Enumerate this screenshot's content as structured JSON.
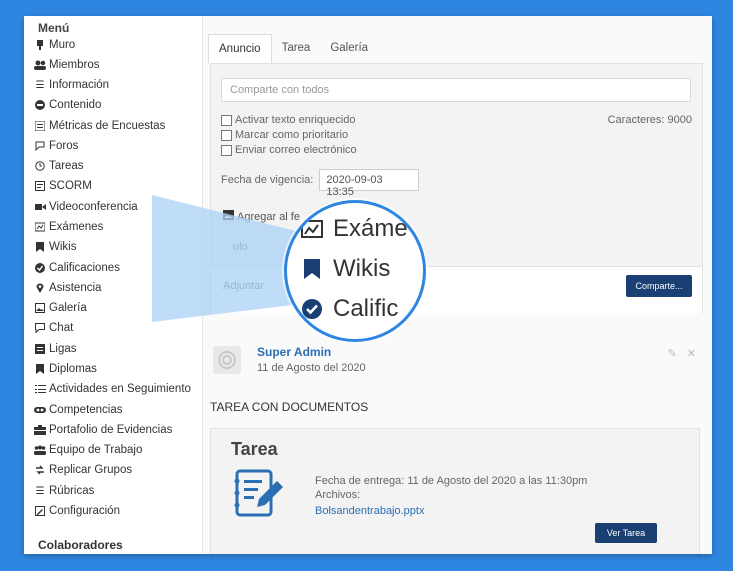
{
  "sidebar": {
    "menu_title": "Menú",
    "items": [
      {
        "label": "Muro",
        "icon": "pin-icon"
      },
      {
        "label": "Miembros",
        "icon": "members-icon"
      },
      {
        "label": "Información",
        "icon": "list-icon"
      },
      {
        "label": "Contenido",
        "icon": "content-icon"
      },
      {
        "label": "Métricas de Encuestas",
        "icon": "metrics-icon"
      },
      {
        "label": "Foros",
        "icon": "forum-icon"
      },
      {
        "label": "Tareas",
        "icon": "clock-icon"
      },
      {
        "label": "SCORM",
        "icon": "scorm-icon"
      },
      {
        "label": "Videoconferencia",
        "icon": "video-icon"
      },
      {
        "label": "Exámenes",
        "icon": "exam-icon"
      },
      {
        "label": "Wikis",
        "icon": "bookmark-icon"
      },
      {
        "label": "Calificaciones",
        "icon": "check-badge-icon"
      },
      {
        "label": "Asistencia",
        "icon": "location-icon"
      },
      {
        "label": "Galería",
        "icon": "gallery-icon"
      },
      {
        "label": "Chat",
        "icon": "chat-icon"
      },
      {
        "label": "Ligas",
        "icon": "links-icon"
      },
      {
        "label": "Diplomas",
        "icon": "bookmark-icon"
      },
      {
        "label": "Actividades en Seguimiento",
        "icon": "tracking-icon"
      },
      {
        "label": "Competencias",
        "icon": "competencies-icon"
      },
      {
        "label": "Portafolio de Evidencias",
        "icon": "portfolio-icon"
      },
      {
        "label": "Equipo de Trabajo",
        "icon": "team-icon"
      },
      {
        "label": "Replicar Grupos",
        "icon": "replicate-icon"
      },
      {
        "label": "Rúbricas",
        "icon": "rubric-icon"
      },
      {
        "label": "Configuración",
        "icon": "settings-icon"
      }
    ],
    "collaborators_title": "Colaboradores"
  },
  "main": {
    "tabs": [
      {
        "label": "Anuncio",
        "active": true
      },
      {
        "label": "Tarea",
        "active": false
      },
      {
        "label": "Galería",
        "active": false
      }
    ],
    "share_placeholder": "Comparte con todos",
    "checkboxes": [
      {
        "label": "Activar texto enriquecido"
      },
      {
        "label": "Marcar como prioritario"
      },
      {
        "label": "Enviar correo electrónico"
      }
    ],
    "characters": "Caracteres: 9000",
    "expiry_label": "Fecha de vigencia:",
    "expiry_value": "2020-09-03 13:35",
    "add_feed_partial": "Agregar al fe",
    "title_partial": "ulo",
    "attach_partial": "Adjuntar",
    "share_button": "Comparte..."
  },
  "post": {
    "author": "Super Admin",
    "date": "11 de Agosto del 2020",
    "title": "TAREA CON DOCUMENTOS",
    "card": {
      "heading": "Tarea",
      "due": "Fecha de entrega: 11 de Agosto del 2020 a las 11:30pm",
      "files_label": "Archivos:",
      "file_name": "Bolsandentrabajo.pptx",
      "view_button": "Ver Tarea"
    }
  },
  "magnifier": {
    "items": [
      {
        "label": "Exáme",
        "icon": "exam-icon"
      },
      {
        "label": "Wikis",
        "icon": "bookmark-icon"
      },
      {
        "label": "Calific",
        "icon": "check-badge-icon"
      }
    ]
  },
  "colors": {
    "background_blue": "#2f86e0",
    "button_navy": "#1a3f73",
    "link_blue": "#2a6fb4"
  }
}
